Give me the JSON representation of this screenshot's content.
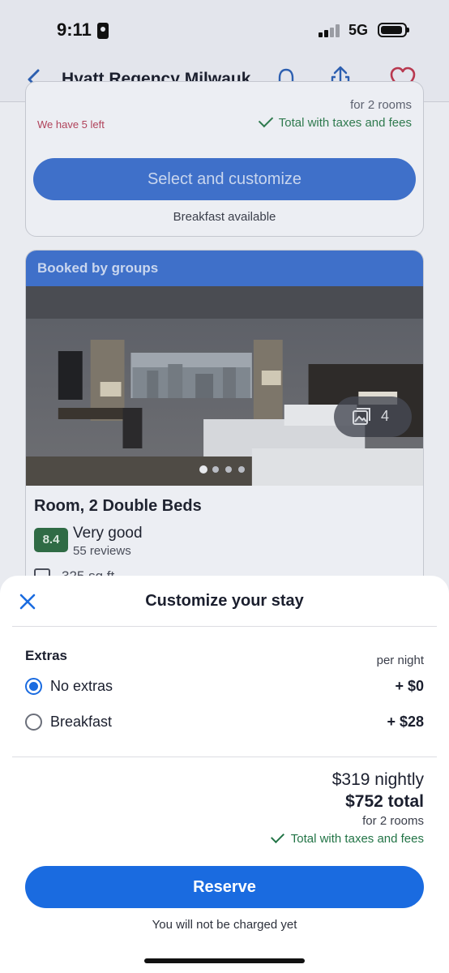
{
  "status_bar": {
    "time": "9:11",
    "network": "5G"
  },
  "header": {
    "title": "Hyatt Regency Milwauk..."
  },
  "card_top": {
    "rooms_note": "for 2 rooms",
    "availability": "We have 5 left",
    "total_note": "Total with taxes and fees",
    "select_button": "Select and customize",
    "breakfast_note": "Breakfast available"
  },
  "room_card": {
    "banner": "Booked by groups",
    "photo_count": "4",
    "photo_index": 1,
    "photo_total": 4,
    "name": "Room, 2 Double Beds",
    "rating_score": "8.4",
    "rating_label": "Very good",
    "reviews": "55 reviews",
    "area": "325 sq ft"
  },
  "sheet": {
    "title": "Customize your stay",
    "extras_label": "Extras",
    "per_night_label": "per night",
    "options": [
      {
        "label": "No extras",
        "price": "+ $0",
        "selected": true
      },
      {
        "label": "Breakfast",
        "price": "+ $28",
        "selected": false
      }
    ],
    "nightly": "$319 nightly",
    "total": "$752 total",
    "rooms_note": "for 2 rooms",
    "taxes_note": "Total with taxes and fees",
    "reserve_button": "Reserve",
    "charge_note": "You will not be charged yet"
  },
  "colors": {
    "primary": "#1a6be0",
    "rating_green": "#2f6b45",
    "success_green": "#227446",
    "availability_red": "#b0425a"
  }
}
